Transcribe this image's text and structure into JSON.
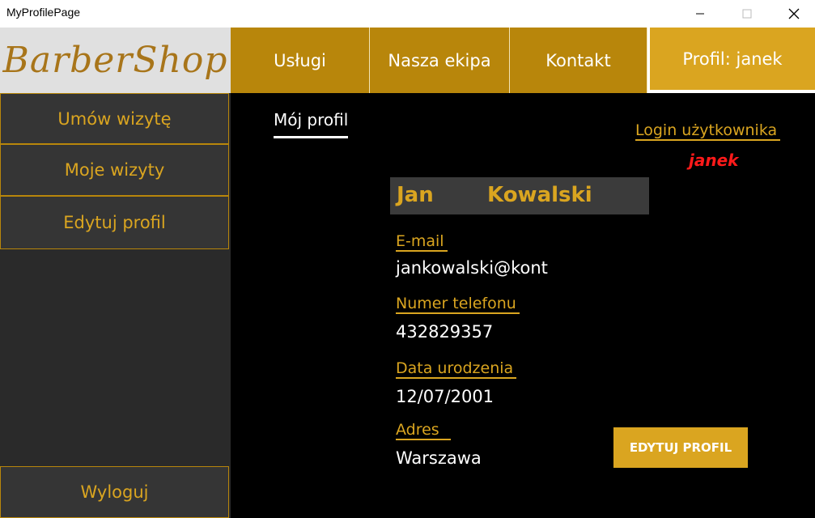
{
  "window": {
    "title": "MyProfilePage"
  },
  "logo": {
    "text": "BarberShop"
  },
  "nav": {
    "uslugi": "Usługi",
    "ekipa": "Nasza ekipa",
    "kontakt": "Kontakt",
    "profil": "Profil: janek"
  },
  "sidebar": {
    "umow": "Umów wizytę",
    "moje": "Moje wizyty",
    "edytuj": "Edytuj profil",
    "wyloguj": "Wyloguj"
  },
  "main": {
    "tab_label": "Mój profil",
    "login_label": "Login użytkownika",
    "login_value": "janek",
    "first_name": "Jan",
    "last_name": "Kowalski",
    "email_label": "E-mail",
    "email_value": "jankowalski@kont",
    "phone_label": "Numer telefonu",
    "phone_value": "432829357",
    "dob_label": "Data urodzenia",
    "dob_value": "12/07/2001",
    "address_label": "Adres",
    "address_value": "Warszawa",
    "edit_button": "EDYTUJ PROFIL"
  },
  "colors": {
    "accent": "#daa520",
    "nav": "#b8860b",
    "sidebar": "#2a2a2a",
    "login_value": "#ff1a1a"
  }
}
